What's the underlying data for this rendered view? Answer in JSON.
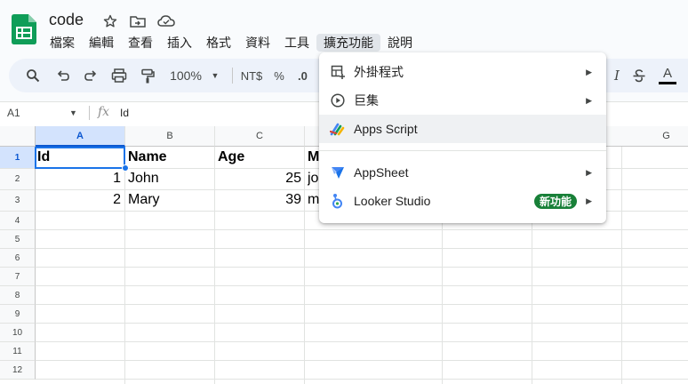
{
  "app": {
    "doc_title": "code",
    "menu": [
      "檔案",
      "編輯",
      "查看",
      "插入",
      "格式",
      "資料",
      "工具",
      "擴充功能",
      "說明"
    ],
    "active_menu": "擴充功能"
  },
  "toolbar": {
    "zoom": "100%",
    "currency": "NT$",
    "percent": "%",
    "decimal": ".0"
  },
  "formula_bar": {
    "name_box": "A1",
    "fx": "fx",
    "content": "Id"
  },
  "grid": {
    "columns": [
      "A",
      "B",
      "C",
      "",
      "",
      "",
      "G"
    ],
    "rows": [
      "1",
      "2",
      "3",
      "4",
      "5",
      "6",
      "7",
      "8",
      "9",
      "10",
      "11",
      "12"
    ],
    "cells": {
      "A1": "Id",
      "B1": "Name",
      "C1": "Age",
      "D1": "M",
      "A2": "1",
      "B2": "John",
      "C2": "25",
      "D2": "jo",
      "A3": "2",
      "B3": "Mary",
      "C3": "39",
      "D3": "m"
    }
  },
  "extensions_menu": {
    "items": [
      {
        "label": "外掛程式",
        "icon": "addon-icon",
        "submenu": true
      },
      {
        "label": "巨集",
        "icon": "play-circle-icon",
        "submenu": true
      },
      {
        "label": "Apps Script",
        "icon": "apps-script-icon",
        "submenu": false
      },
      {
        "label": "AppSheet",
        "icon": "appsheet-icon",
        "submenu": true
      },
      {
        "label": "Looker Studio",
        "icon": "looker-studio-icon",
        "submenu": true,
        "badge": "新功能"
      }
    ]
  },
  "colors": {
    "brand_green": "#0f9d58",
    "selection_blue": "#1a73e8",
    "badge_green": "#188038"
  }
}
